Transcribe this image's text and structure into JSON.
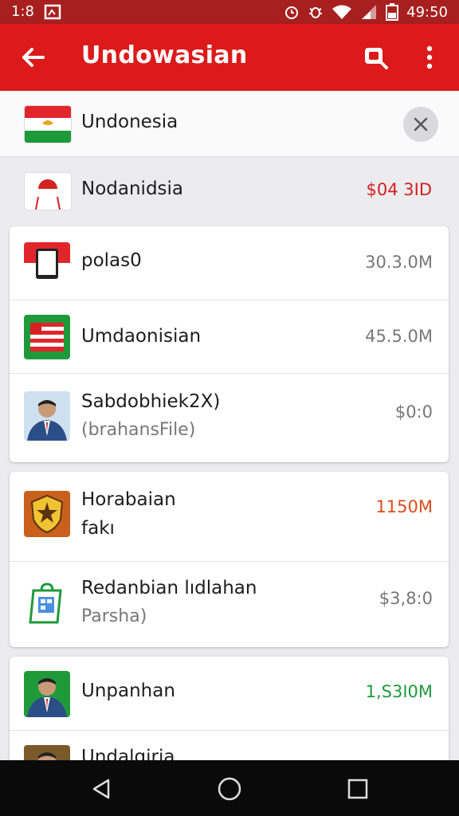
{
  "status_bar": {
    "time_left": "1:8",
    "time_right": "49:50",
    "icons": [
      "image-icon",
      "alarm-icon",
      "bug-icon",
      "wifi-icon",
      "signal-icon",
      "battery-icon"
    ]
  },
  "app_bar": {
    "title": "Undowasian",
    "icons": [
      "back-arrow-icon",
      "search-icon",
      "more-vert-icon"
    ]
  },
  "search": {
    "value": "Undonesia",
    "clear_icon": "close-icon"
  },
  "selected": {
    "title": "Nodanidsia",
    "value": "$04 3ID",
    "value_color": "#d32020"
  },
  "cards": [
    {
      "rows": [
        {
          "title": "polas0",
          "subtitle": "",
          "value": "30.3.0M",
          "value_color": "#777777",
          "icon": "tablet-flag-icon"
        },
        {
          "title": "Umdaonisian",
          "subtitle": "",
          "value": "45.5.0M",
          "value_color": "#777777",
          "icon": "striped-flag-icon"
        },
        {
          "title": "Sabdobhiek2X)",
          "subtitle": "(brahansFile)",
          "value": "$0:0",
          "value_color": "#777777",
          "icon": "person-avatar-icon"
        }
      ]
    },
    {
      "rows": [
        {
          "title": "Horabaian",
          "subtitle": "fakı",
          "value": "1150M",
          "value_color": "#e04a1a",
          "icon": "emblem-icon"
        },
        {
          "title": "Redanbian lıdlahan",
          "subtitle": "Parsha)",
          "value": "$3,8:0",
          "value_color": "#777777",
          "icon": "shopping-bag-icon"
        }
      ]
    },
    {
      "rows": [
        {
          "title": "Unpanhan",
          "subtitle": "",
          "value": "1,S3I0M",
          "value_color": "#1e9a3c",
          "icon": "person-avatar-green-icon"
        },
        {
          "title": "Undalgiria",
          "subtitle": "",
          "value": "",
          "value_color": "#1e9a3c",
          "icon": "person-avatar-icon"
        }
      ]
    }
  ],
  "nav_bar": {
    "icons": [
      "back-triangle-icon",
      "home-circle-icon",
      "recents-square-icon"
    ]
  }
}
